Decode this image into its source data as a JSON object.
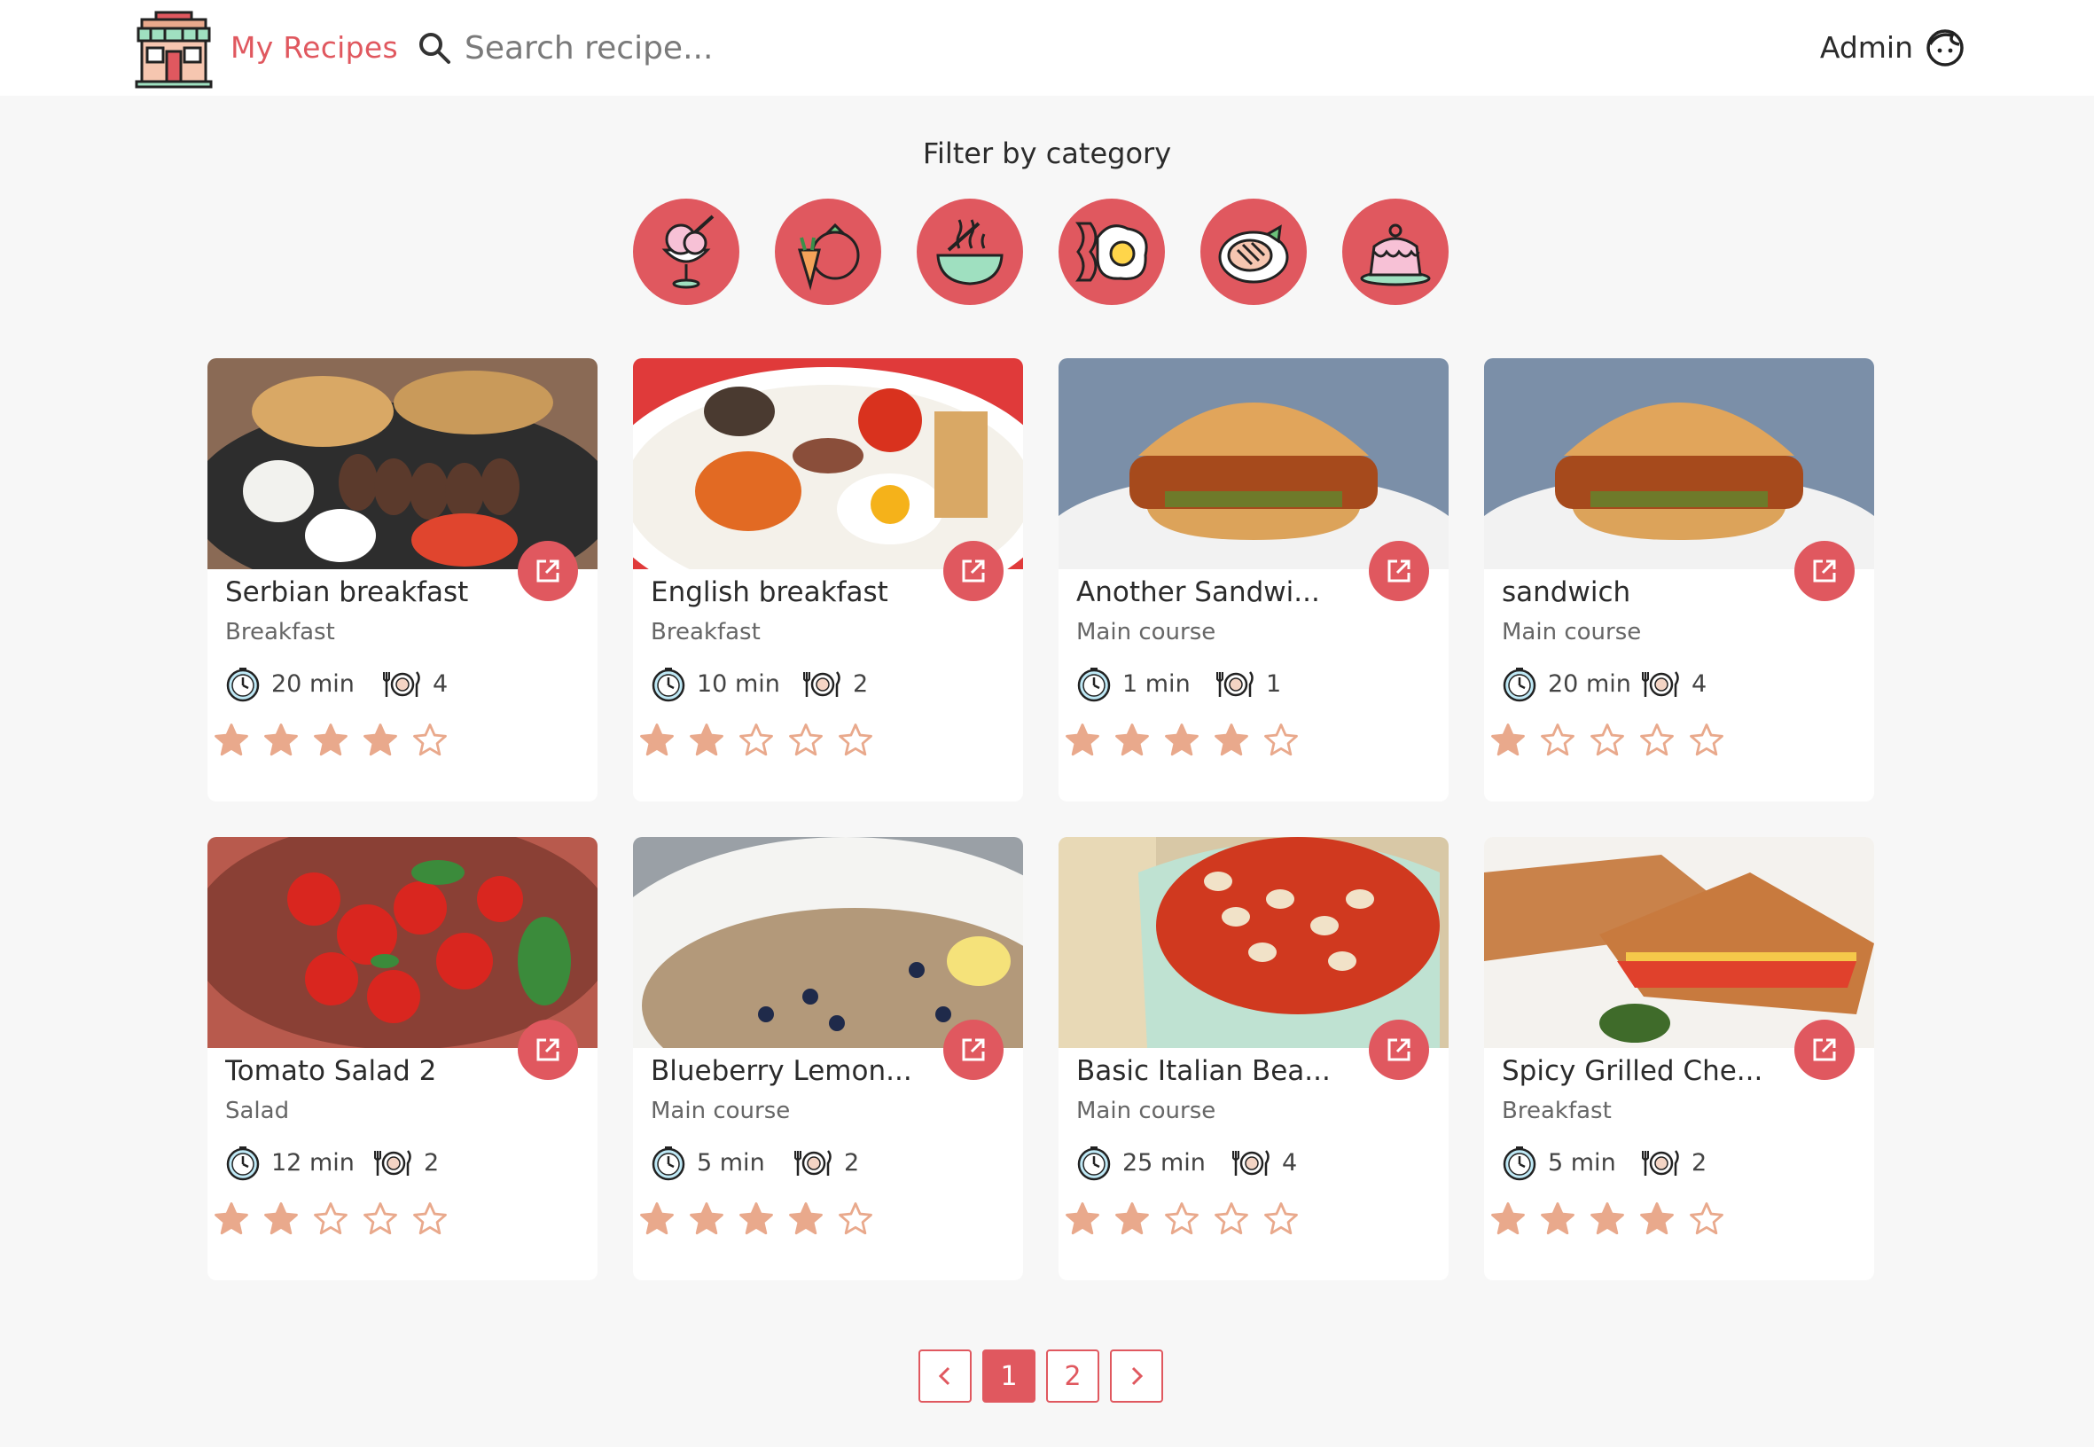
{
  "header": {
    "brand": "My Recipes",
    "search_placeholder": "Search recipe...",
    "user_name": "Admin"
  },
  "filter": {
    "title": "Filter by category",
    "categories": [
      "dessert-icon",
      "vegetables-icon",
      "soup-icon",
      "breakfast-icon",
      "meat-icon",
      "cake-icon"
    ]
  },
  "recipes": [
    {
      "title": "Serbian breakfast",
      "category": "Breakfast",
      "time": "20 min",
      "servings": "4",
      "rating": 4
    },
    {
      "title": "English breakfast",
      "category": "Breakfast",
      "time": "10 min",
      "servings": "2",
      "rating": 2
    },
    {
      "title": "Another Sandwi...",
      "category": "Main course",
      "time": "1 min",
      "servings": "1",
      "rating": 4
    },
    {
      "title": "sandwich",
      "category": "Main course",
      "time": "20 min",
      "servings": "4",
      "rating": 1
    },
    {
      "title": "Tomato Salad 2",
      "category": "Salad",
      "time": "12 min",
      "servings": "2",
      "rating": 2
    },
    {
      "title": "Blueberry Lemon...",
      "category": "Main course",
      "time": "5 min",
      "servings": "2",
      "rating": 4
    },
    {
      "title": "Basic Italian Bea...",
      "category": "Main course",
      "time": "25 min",
      "servings": "4",
      "rating": 2
    },
    {
      "title": "Spicy Grilled Che...",
      "category": "Breakfast",
      "time": "5 min",
      "servings": "2",
      "rating": 4
    }
  ],
  "pagination": {
    "pages": [
      "1",
      "2"
    ],
    "current": "1"
  },
  "colors": {
    "accent": "#e0585f",
    "star": "#e9a98c",
    "background": "#f7f7f7"
  }
}
